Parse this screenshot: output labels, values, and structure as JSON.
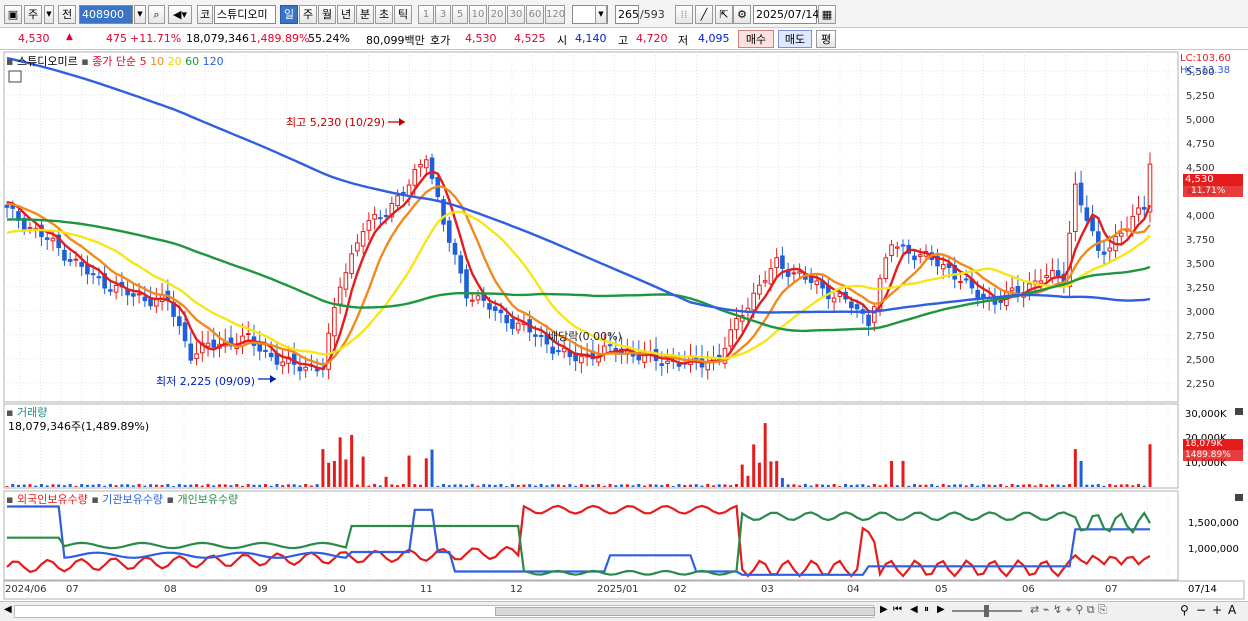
{
  "toolbar": {
    "market": "주",
    "prev": "전",
    "code": "408900",
    "kind": "코",
    "name": "스튜디오미",
    "periods": [
      "일",
      "주",
      "월",
      "년",
      "분",
      "초",
      "틱"
    ],
    "active_period": "일",
    "intervals": [
      "1",
      "3",
      "5",
      "10",
      "20",
      "30",
      "60",
      "120"
    ],
    "count": "265",
    "total": "/593",
    "date": "2025/07/14"
  },
  "info": {
    "price": "4,530",
    "change": "475",
    "change_pct": "+11.71%",
    "volume": "18,079,346",
    "vol_ratio": "1,489.89%",
    "rate": "55.24%",
    "amount": "80,099백만",
    "quote_label": "호가",
    "ask": "4,530",
    "bid": "4,525",
    "open_label": "시",
    "open": "4,140",
    "high_label": "고",
    "high": "4,720",
    "low_label": "저",
    "low": "4,095",
    "buy": "매수",
    "sell": "매도",
    "avg": "평"
  },
  "price_panel": {
    "legend_name": "스튜디오미르",
    "legend_ma": "종가 단순",
    "ma_periods": [
      "5",
      "10",
      "20",
      "60",
      "120"
    ],
    "ma_colors": [
      "#e51c1c",
      "#f08a1c",
      "#f5e61a",
      "#1e9640",
      "#2f5ee0"
    ],
    "lc": "LC:103.60",
    "hc": "HC:-13.38",
    "last_price": "4,530",
    "last_pct": "11.71%",
    "high_note": "최고 5,230 (10/29)",
    "low_note": "최저 2,225 (09/09)",
    "dividend_note": "배당락(0.00%)"
  },
  "volume_panel": {
    "title": "거래량",
    "value": "18,079,346주(1,489.89%)",
    "axis": [
      "30,000K",
      "20,000K",
      "10,000K"
    ],
    "last_vol": "18,079K",
    "last_pct": "1489.89%"
  },
  "holdings_panel": {
    "series": [
      "외국인보유수량",
      "기관보유수량",
      "개인보유수량"
    ],
    "colors": [
      "#e51c1c",
      "#2f5ee0",
      "#2a8a4a"
    ],
    "axis": [
      "1,500,000",
      "1,000,000"
    ]
  },
  "x_axis": [
    "2024/06",
    "07",
    "08",
    "09",
    "10",
    "11",
    "12",
    "2025/01",
    "02",
    "03",
    "04",
    "05",
    "06",
    "07"
  ],
  "x_axis_right": "07/14",
  "chart_data": {
    "type": "candlestick",
    "y_ticks": [
      5500,
      5250,
      5000,
      4750,
      4500,
      4250,
      4000,
      3750,
      3500,
      3250,
      3000,
      2750,
      2500,
      2250
    ],
    "ylim": [
      2050,
      5700
    ],
    "close_anchors": [
      [
        0,
        4050
      ],
      [
        8,
        3700
      ],
      [
        15,
        3350
      ],
      [
        22,
        3150
      ],
      [
        28,
        3100
      ],
      [
        32,
        2550
      ],
      [
        36,
        2650
      ],
      [
        42,
        2700
      ],
      [
        48,
        2450
      ],
      [
        55,
        2400
      ],
      [
        58,
        3300
      ],
      [
        62,
        3850
      ],
      [
        66,
        4050
      ],
      [
        70,
        4300
      ],
      [
        73,
        4650
      ],
      [
        76,
        3900
      ],
      [
        80,
        3200
      ],
      [
        86,
        2950
      ],
      [
        92,
        2750
      ],
      [
        98,
        2500
      ],
      [
        106,
        2600
      ],
      [
        112,
        2500
      ],
      [
        118,
        2450
      ],
      [
        124,
        2500
      ],
      [
        128,
        3000
      ],
      [
        134,
        3500
      ],
      [
        140,
        3300
      ],
      [
        146,
        3100
      ],
      [
        150,
        2900
      ],
      [
        154,
        3700
      ],
      [
        158,
        3600
      ],
      [
        164,
        3450
      ],
      [
        168,
        3200
      ],
      [
        172,
        3100
      ],
      [
        176,
        3200
      ],
      [
        180,
        3350
      ],
      [
        184,
        3350
      ],
      [
        186,
        4300
      ],
      [
        190,
        3600
      ],
      [
        194,
        3800
      ],
      [
        198,
        4100
      ],
      [
        199,
        4530
      ]
    ],
    "volume_max": 30000,
    "holdings_ylim": [
      700000,
      1900000
    ]
  }
}
